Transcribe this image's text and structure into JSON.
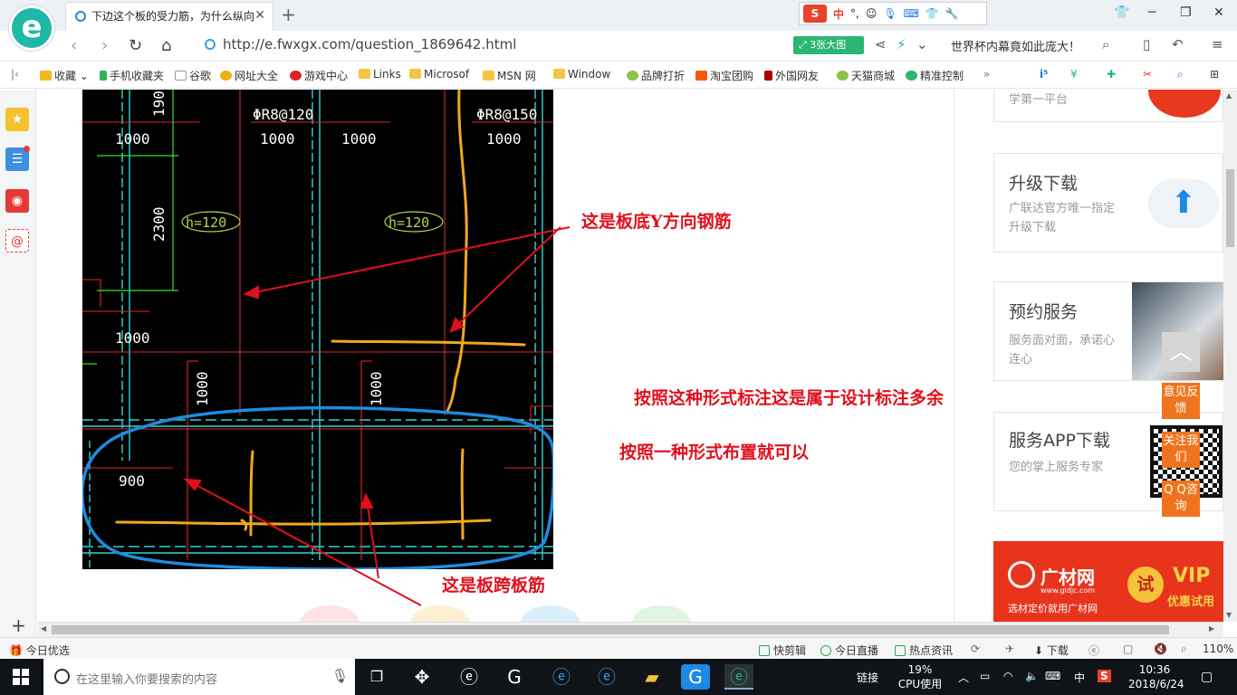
{
  "browser": {
    "tab_title": "下边这个板的受力筋，为什么纵向",
    "url": "http://e.fwxgx.com/question_1869642.html",
    "big_image_label": "3张大图",
    "news_text": "世界杯内幕竟如此庞大！",
    "logo_letter": "e",
    "ime_badge": "S",
    "ime_lang": "中"
  },
  "bookmarks": [
    {
      "label": "收藏",
      "icon": "star-icon"
    },
    {
      "label": "手机收藏夹",
      "icon": "phone-icon"
    },
    {
      "label": "谷歌",
      "icon": "page-icon"
    },
    {
      "label": "网址大全",
      "icon": "site-icon"
    },
    {
      "label": "游戏中心",
      "icon": "game-icon"
    },
    {
      "label": "Links",
      "icon": "folder-icon"
    },
    {
      "label": "Microsof",
      "icon": "folder-icon"
    },
    {
      "label": "MSN 网",
      "icon": "folder-icon"
    },
    {
      "label": "Window",
      "icon": "folder-icon"
    },
    {
      "label": "品牌打折",
      "icon": "leaf-icon"
    },
    {
      "label": "淘宝团购",
      "icon": "taobao-icon"
    },
    {
      "label": "外国网友",
      "icon": "flag-icon"
    },
    {
      "label": "天猫商城",
      "icon": "leaf-icon"
    },
    {
      "label": "精准控制",
      "icon": "chat-icon"
    }
  ],
  "drawing": {
    "labels": {
      "rebar_a": "ΦR8@120",
      "rebar_b": "ΦR8@150",
      "dim_1000": "1000",
      "dim_1900": "1900",
      "dim_2300": "2300",
      "dim_900": "900",
      "thickness": "h=120"
    }
  },
  "annotations": {
    "y_direction": "这是板底Y方向钢筋",
    "redundant": "按照这种形式标注这是属于设计标注多余",
    "one_form": "按照一种形式布置就可以",
    "span_bar": "这是板跨板筋"
  },
  "sidebar": {
    "card0_desc": "学第一平台",
    "card1_title": "升级下载",
    "card1_desc": "广联达官方唯一指定升级下载",
    "card2_title": "预约服务",
    "card2_desc": "服务面对面，承诺心连心",
    "card3_title": "服务APP下载",
    "card3_desc": "您的掌上服务专家",
    "ad_brand": "广材网",
    "ad_url": "www.gldjc.com",
    "ad_slogan": "选材定价就用广材网",
    "ad_try": "试",
    "ad_vip": "VIP",
    "ad_vip_sub": "优惠试用"
  },
  "float_tools": [
    "意见反馈",
    "关注我们",
    "Q Q咨询"
  ],
  "statusbar": {
    "left": "今日优选",
    "items": [
      "快剪辑",
      "今日直播",
      "热点资讯",
      "下载"
    ],
    "zoom": "110%"
  },
  "taskbar": {
    "search_placeholder": "在这里输入你要搜索的内容",
    "link_label": "链接",
    "cpu_percent": "19%",
    "cpu_label": "CPU使用",
    "lang": "中",
    "time": "10:36",
    "date": "2018/6/24"
  }
}
